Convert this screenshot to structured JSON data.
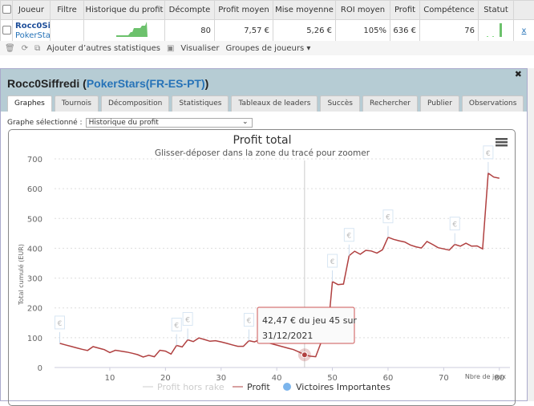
{
  "table": {
    "headers": [
      "Joueur",
      "Filtre",
      "Historique du profit",
      "Décompte",
      "Profit moyen",
      "Mise moyenne",
      "ROI moyen",
      "Profit",
      "Compétence",
      "Statut"
    ],
    "row": {
      "player": "Rocc0Siffredi",
      "network": "PokerStars",
      "filter": "",
      "count": "80",
      "avg_profit": "7,57 €",
      "avg_stake": "5,26 €",
      "roi": "105%",
      "profit": "636 €",
      "skill": "76",
      "remove": "x"
    }
  },
  "toolbar": {
    "add_stats": "Ajouter d’autres statistiques",
    "view": "Visualiser",
    "groups": "Groupes de joueurs ▾"
  },
  "dialog": {
    "player": "Rocc0Siffredi",
    "open": " (",
    "network": "PokerStars(FR-ES-PT)",
    "close_paren": ")",
    "close": "✖",
    "tabs": [
      "Graphes",
      "Tournois",
      "Décomposition",
      "Statistiques",
      "Tableaux de leaders",
      "Succès",
      "Rechercher",
      "Publier",
      "Observations"
    ],
    "active_tab": "Graphes",
    "graph_label": "Graphe sélectionné :",
    "graph_value": "Historique du profit"
  },
  "colors": {
    "profit": "#b04040",
    "marker": "#7cb5ec",
    "header": "#b6ccd4",
    "link": "#2673b8"
  },
  "chart_data": {
    "type": "line",
    "title": "Profit total",
    "subtitle": "Glisser-déposer dans la zone du tracé pour zoomer",
    "xlabel": "Nbre de jeux",
    "ylabel": "Total cumulé (EUR)",
    "xlim": [
      1,
      80
    ],
    "ylim": [
      0,
      700
    ],
    "xticks": [
      "10",
      "20",
      "30",
      "40",
      "50",
      "60",
      "70",
      "80"
    ],
    "yticks": [
      "0",
      "100",
      "200",
      "300",
      "400",
      "500",
      "600",
      "700"
    ],
    "grid": true,
    "legend": [
      "Profit hors rake",
      "Profit",
      "Victoires Importantes"
    ],
    "legend_position": "bottom",
    "series": [
      {
        "name": "Profit",
        "x": [
          1,
          2,
          3,
          4,
          5,
          6,
          7,
          8,
          9,
          10,
          11,
          12,
          13,
          14,
          15,
          16,
          17,
          18,
          19,
          20,
          21,
          22,
          23,
          24,
          25,
          26,
          27,
          28,
          29,
          30,
          31,
          32,
          33,
          34,
          35,
          36,
          37,
          38,
          39,
          40,
          41,
          42,
          43,
          44,
          45,
          46,
          47,
          48,
          49,
          50,
          51,
          52,
          53,
          54,
          55,
          56,
          57,
          58,
          59,
          60,
          61,
          62,
          63,
          64,
          65,
          66,
          67,
          68,
          69,
          70,
          71,
          72,
          73,
          74,
          75,
          76,
          77,
          78,
          79,
          80
        ],
        "values": [
          81,
          76,
          71,
          66,
          61,
          57,
          70,
          65,
          60,
          50,
          58,
          55,
          52,
          48,
          43,
          35,
          41,
          36,
          58,
          55,
          45,
          74,
          69,
          93,
          87,
          99,
          94,
          88,
          90,
          86,
          81,
          76,
          71,
          71,
          90,
          86,
          94,
          85,
          80,
          75,
          70,
          65,
          60,
          52,
          42.47,
          38,
          36,
          86,
          86,
          288,
          278,
          280,
          375,
          390,
          380,
          393,
          391,
          384,
          395,
          437,
          430,
          425,
          421,
          411,
          405,
          401,
          423,
          413,
          402,
          398,
          394,
          413,
          407,
          417,
          407,
          408,
          398,
          652,
          639,
          635
        ]
      }
    ],
    "important_wins": [
      1,
      22,
      24,
      35,
      48,
      50,
      53,
      60,
      72,
      78
    ],
    "marker_symbol": "€",
    "tooltip": {
      "line1": "42,47 € du jeu 45 sur",
      "line2": "31/12/2021",
      "x": 45,
      "y": 42.47
    }
  }
}
